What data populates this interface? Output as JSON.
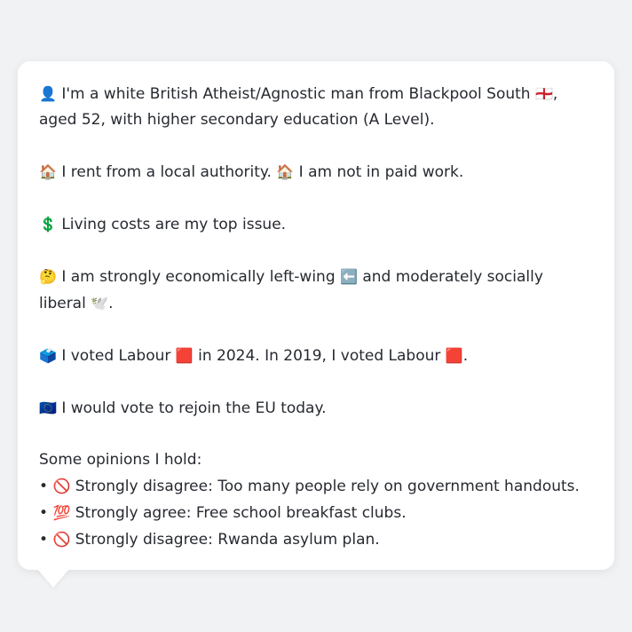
{
  "profile": {
    "intro": {
      "icon": "👤",
      "text": "I'm a white British Atheist/Agnostic man from Blackpool South",
      "flag": "🏴󠁧󠁢󠁥󠁮󠁧󠁿",
      "text2": ", aged 52, with higher secondary education (A Level)."
    },
    "housing": {
      "icon": "🏠",
      "text": "I rent from a local authority.",
      "icon2": "🏠",
      "text2": "I am not in paid work."
    },
    "issue": {
      "icon": "💲",
      "text": "Living costs are my top issue."
    },
    "ideology": {
      "icon": "🤔",
      "text": "I am strongly economically left-wing",
      "icon2": "⬅️",
      "text2": "and moderately socially liberal",
      "icon3": "🕊️",
      "text3": "."
    },
    "voting": {
      "icon": "🗳️",
      "text": "I voted Labour",
      "icon2": "🟥",
      "text2": "in 2024. In 2019, I voted Labour",
      "icon3": "🟥",
      "text3": "."
    },
    "eu": {
      "icon": "🇪🇺",
      "text": "I would vote to rejoin the EU today."
    },
    "opinions_heading": "Some opinions I hold:",
    "opinions": [
      {
        "bullet": "•",
        "icon": "🚫",
        "text": "Strongly disagree: Too many people rely on government handouts."
      },
      {
        "bullet": "•",
        "icon": "💯",
        "text": "Strongly agree: Free school breakfast clubs."
      },
      {
        "bullet": "•",
        "icon": "🚫",
        "text": "Strongly disagree: Rwanda asylum plan."
      }
    ]
  }
}
